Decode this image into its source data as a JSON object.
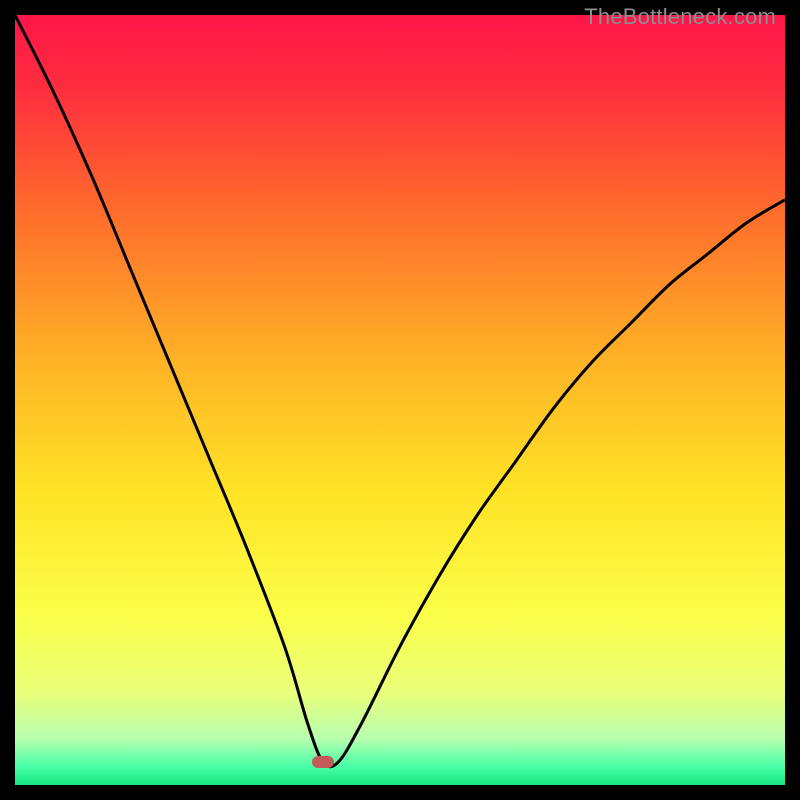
{
  "watermark": "TheBottleneck.com",
  "colors": {
    "bg": "#000000",
    "curve": "#000000",
    "marker": "#c55a5a",
    "gradient_stops": [
      {
        "offset": 0.0,
        "color": "#ff1548"
      },
      {
        "offset": 0.1,
        "color": "#ff2f3e"
      },
      {
        "offset": 0.25,
        "color": "#ff6a2c"
      },
      {
        "offset": 0.45,
        "color": "#ffb326"
      },
      {
        "offset": 0.62,
        "color": "#ffe326"
      },
      {
        "offset": 0.78,
        "color": "#fbff4a"
      },
      {
        "offset": 0.88,
        "color": "#e9ff7a"
      },
      {
        "offset": 0.94,
        "color": "#b8ffb0"
      },
      {
        "offset": 0.975,
        "color": "#4bffa6"
      },
      {
        "offset": 1.0,
        "color": "#17e884"
      }
    ]
  },
  "chart_data": {
    "type": "line",
    "title": "",
    "xlabel": "",
    "ylabel": "",
    "xlim": [
      0,
      100
    ],
    "ylim": [
      0,
      100
    ],
    "grid": false,
    "legend": false,
    "notes": "V-shaped bottleneck curve; minimum at x≈40. Background is a vertical gradient from red (top, high bottleneck) to green (bottom, low bottleneck). Small rounded marker sits at the curve minimum.",
    "series": [
      {
        "name": "bottleneck-curve",
        "x": [
          0,
          5,
          10,
          15,
          20,
          25,
          30,
          35,
          38,
          40,
          42,
          45,
          50,
          55,
          60,
          65,
          70,
          75,
          80,
          85,
          90,
          95,
          100
        ],
        "y": [
          100,
          90,
          79,
          67,
          55,
          43,
          31,
          18,
          8,
          3,
          3,
          8,
          18,
          27,
          35,
          42,
          49,
          55,
          60,
          65,
          69,
          73,
          76
        ]
      }
    ],
    "marker": {
      "x": 40,
      "y": 3
    }
  }
}
